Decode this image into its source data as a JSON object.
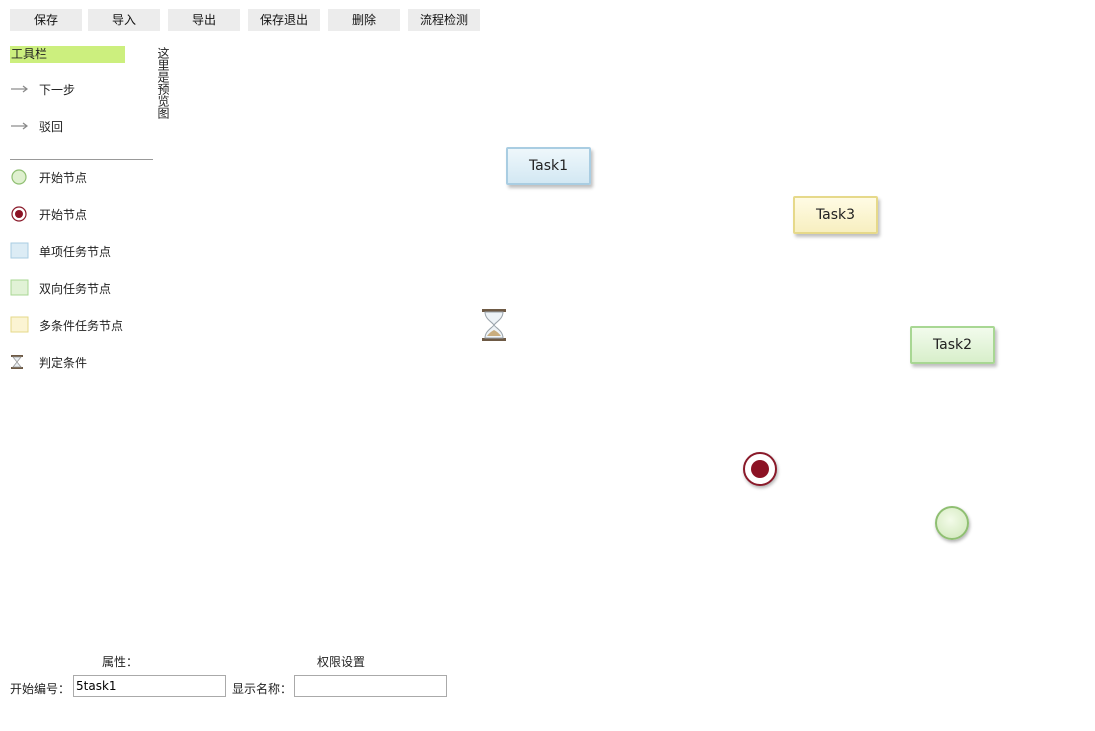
{
  "topbar": {
    "save": "保存",
    "import": "导入",
    "export": "导出",
    "save_exit": "保存退出",
    "delete": "删除",
    "check_flow": "流程检测"
  },
  "toolbar": {
    "title": "工具栏",
    "next_step": "下一步",
    "reject": "驳回",
    "start_node": "开始节点",
    "end_node": "开始节点",
    "single_task": "单项任务节点",
    "dual_task": "双向任务节点",
    "multi_task": "多条件任务节点",
    "condition": "判定条件"
  },
  "preview": {
    "text": "这里是预览图"
  },
  "canvas": {
    "task1": "Task1",
    "task3": "Task3",
    "task2": "Task2"
  },
  "properties": {
    "title": "属性：",
    "permission_link": "权限设置",
    "start_id_label": "开始编号：",
    "start_id_value": "5task1",
    "display_name_label": "显示名称：",
    "display_name_value": ""
  },
  "colors": {
    "toolbar_highlight": "#ccef7e",
    "end_node": "#8c1224",
    "start_node": "#cde6b6"
  }
}
